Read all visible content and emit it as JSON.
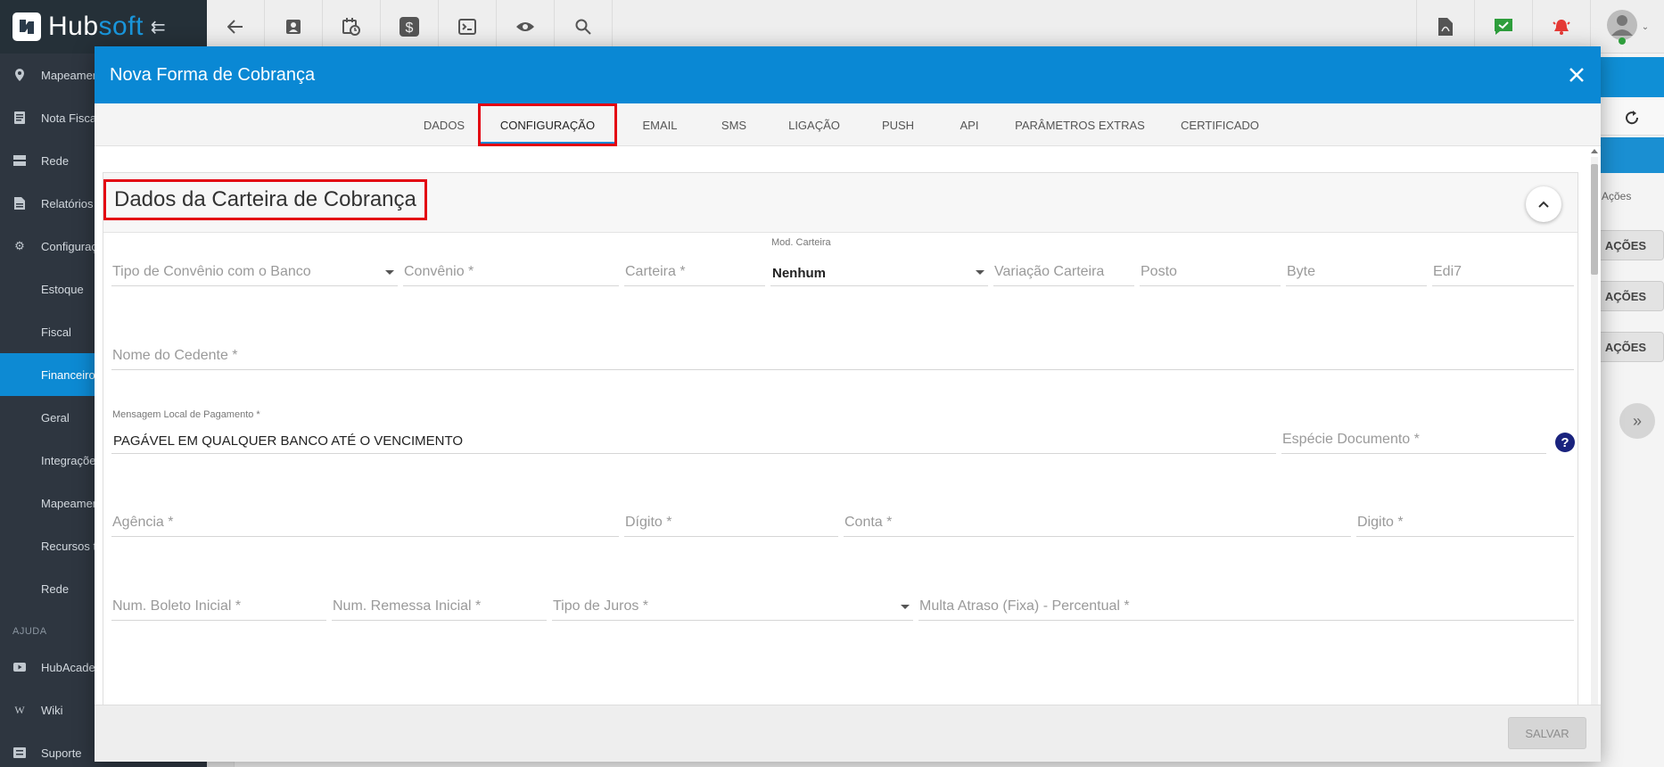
{
  "brand": {
    "name_part1": "Hub",
    "name_part2": "soft"
  },
  "sidebar": {
    "items": [
      {
        "label": "Mapeamento",
        "icon": "map-pin-icon"
      },
      {
        "label": "Nota Fiscal",
        "icon": "document-icon"
      },
      {
        "label": "Rede",
        "icon": "server-icon"
      },
      {
        "label": "Relatórios",
        "icon": "report-icon"
      },
      {
        "label": "Configurações",
        "icon": "gear-icon"
      },
      {
        "label": "Estoque"
      },
      {
        "label": "Fiscal"
      },
      {
        "label": "Financeiro"
      },
      {
        "label": "Geral"
      },
      {
        "label": "Integrações"
      },
      {
        "label": "Mapeamento"
      },
      {
        "label": "Recursos t"
      },
      {
        "label": "Rede"
      }
    ],
    "section_help": "AJUDA",
    "help_items": [
      {
        "label": "HubAcademy",
        "icon": "youtube-icon"
      },
      {
        "label": "Wiki",
        "icon": "wiki-icon"
      },
      {
        "label": "Suporte",
        "icon": "ticket-icon"
      }
    ]
  },
  "background": {
    "acoes_header": "Ações",
    "acoes_buttons": [
      "AÇÕES",
      "AÇÕES",
      "AÇÕES"
    ]
  },
  "modal": {
    "title": "Nova Forma de Cobrança",
    "tabs": [
      "DADOS",
      "CONFIGURAÇÃO",
      "EMAIL",
      "SMS",
      "LIGAÇÃO",
      "PUSH",
      "API",
      "PARÂMETROS EXTRAS",
      "CERTIFICADO"
    ],
    "active_tab": "CONFIGURAÇÃO",
    "section_title": "Dados da Carteira de Cobrança",
    "fields": {
      "tipo_convenio": "Tipo de Convênio com o Banco",
      "convenio": "Convênio *",
      "carteira": "Carteira *",
      "mod_carteira_label": "Mod. Carteira",
      "mod_carteira_value": "Nenhum",
      "variacao_carteira": "Variação Carteira",
      "posto": "Posto",
      "byte": "Byte",
      "edi7": "Edi7",
      "nome_cedente": "Nome do Cedente *",
      "mensagem_label": "Mensagem Local de Pagamento *",
      "mensagem_value": "PAGÁVEL EM QUALQUER BANCO ATÉ O VENCIMENTO",
      "especie_documento": "Espécie Documento *",
      "agencia": "Agência *",
      "digito_agencia": "Dígito *",
      "conta": "Conta *",
      "digito_conta": "Digito *",
      "num_boleto": "Num. Boleto Inicial *",
      "num_remessa": "Num. Remessa Inicial *",
      "tipo_juros": "Tipo de Juros *",
      "multa_atraso": "Multa Atraso (Fixa) - Percentual *"
    },
    "save_label": "SALVAR"
  },
  "colors": {
    "primary": "#0a88d4",
    "sidebar_bg": "#2e3640",
    "highlight": "#e30613"
  }
}
